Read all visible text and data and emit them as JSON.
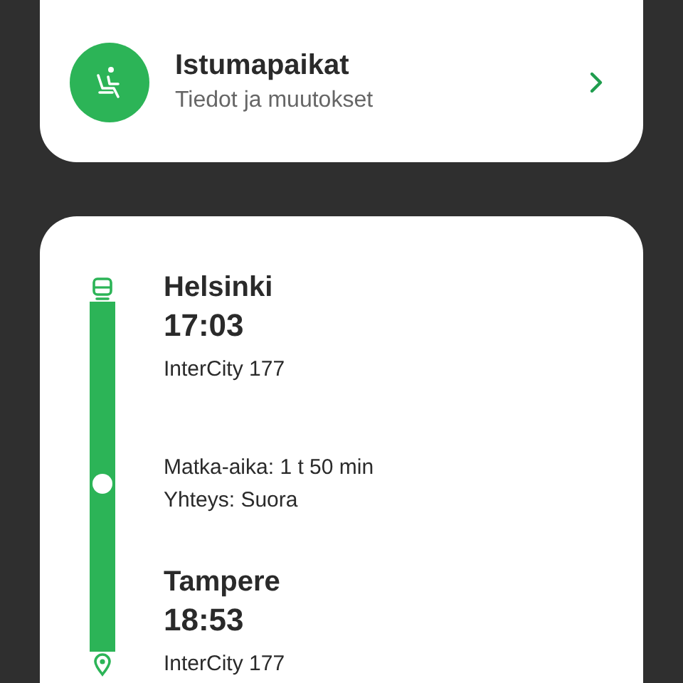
{
  "seat_card": {
    "title": "Istumapaikat",
    "subtitle": "Tiedot ja muutokset"
  },
  "journey": {
    "departure": {
      "station": "Helsinki",
      "time": "17:03",
      "train": "InterCity 177"
    },
    "segment": {
      "duration": "Matka-aika: 1 t 50 min",
      "connection": "Yhteys: Suora"
    },
    "arrival": {
      "station": "Tampere",
      "time": "18:53",
      "train": "InterCity 177"
    }
  }
}
